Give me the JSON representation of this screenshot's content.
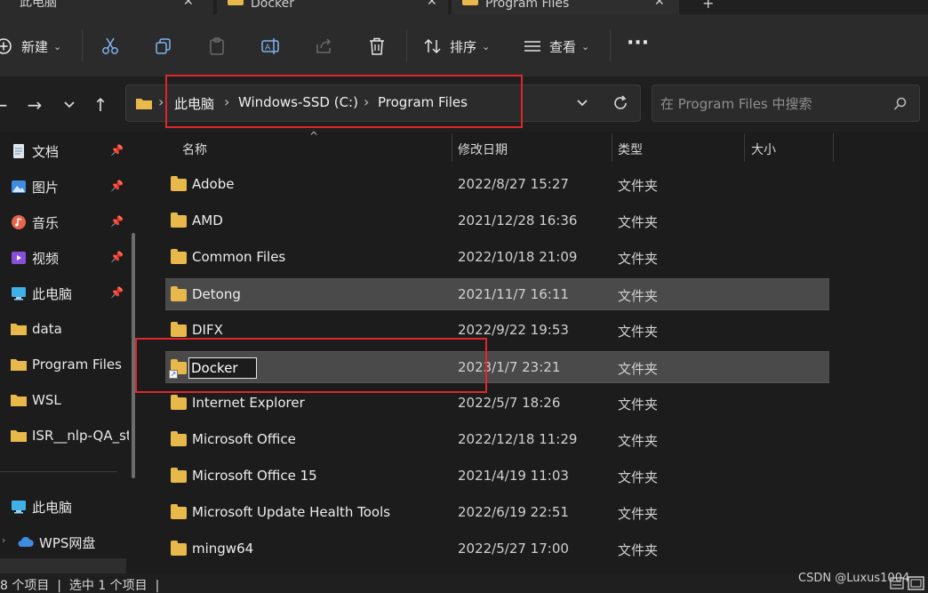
{
  "tabs": [
    {
      "label": "此电脑"
    },
    {
      "label": "Docker"
    },
    {
      "label": "Program Files"
    }
  ],
  "toolbar": {
    "new_label": "新建",
    "sort_label": "排序",
    "view_label": "查看",
    "more_label": "···"
  },
  "breadcrumb": [
    "此电脑",
    "Windows-SSD (C:)",
    "Program Files"
  ],
  "search": {
    "placeholder": "在 Program Files 中搜索"
  },
  "sidebar": {
    "quick_access": [
      {
        "label": "文档",
        "icon": "documents-icon",
        "pinned": true
      },
      {
        "label": "图片",
        "icon": "pictures-icon",
        "pinned": true
      },
      {
        "label": "音乐",
        "icon": "music-icon",
        "pinned": true
      },
      {
        "label": "视频",
        "icon": "videos-icon",
        "pinned": true
      },
      {
        "label": "此电脑",
        "icon": "computer-icon",
        "pinned": true
      },
      {
        "label": "data",
        "icon": "folder-icon",
        "pinned": false
      },
      {
        "label": "Program Files",
        "icon": "folder-icon",
        "pinned": false
      },
      {
        "label": "WSL",
        "icon": "folder-icon",
        "pinned": false
      },
      {
        "label": "ISR__nlp-QA_st",
        "icon": "folder-icon",
        "pinned": false
      }
    ],
    "this_pc_label": "此电脑",
    "wps_label": "WPS网盘"
  },
  "columns": {
    "name": "名称",
    "modified": "修改日期",
    "type": "类型",
    "size": "大小"
  },
  "files": [
    {
      "name": "Adobe",
      "modified": "2022/8/27 15:27",
      "type": "文件夹"
    },
    {
      "name": "AMD",
      "modified": "2021/12/28 16:36",
      "type": "文件夹"
    },
    {
      "name": "Common Files",
      "modified": "2022/10/18 21:09",
      "type": "文件夹"
    },
    {
      "name": "Detong",
      "modified": "2021/11/7 16:11",
      "type": "文件夹",
      "selected": true
    },
    {
      "name": "DIFX",
      "modified": "2022/9/22 19:53",
      "type": "文件夹"
    },
    {
      "name": "Docker",
      "modified": "2023/1/7 23:21",
      "type": "文件夹",
      "selected": true,
      "renaming": true
    },
    {
      "name": "Internet Explorer",
      "modified": "2022/5/7 18:26",
      "type": "文件夹"
    },
    {
      "name": "Microsoft Office",
      "modified": "2022/12/18 11:29",
      "type": "文件夹"
    },
    {
      "name": "Microsoft Office 15",
      "modified": "2021/4/19 11:03",
      "type": "文件夹"
    },
    {
      "name": "Microsoft Update Health Tools",
      "modified": "2022/6/19 22:51",
      "type": "文件夹"
    },
    {
      "name": "mingw64",
      "modified": "2022/5/27 17:00",
      "type": "文件夹"
    }
  ],
  "status": {
    "text": "8 个项目  |  选中 1 个项目  |"
  },
  "watermark": "CSDN @Luxus1004",
  "colors": {
    "accent": "#0a64c8",
    "folder": "#e8b84a",
    "annotation": "#e0262a"
  }
}
